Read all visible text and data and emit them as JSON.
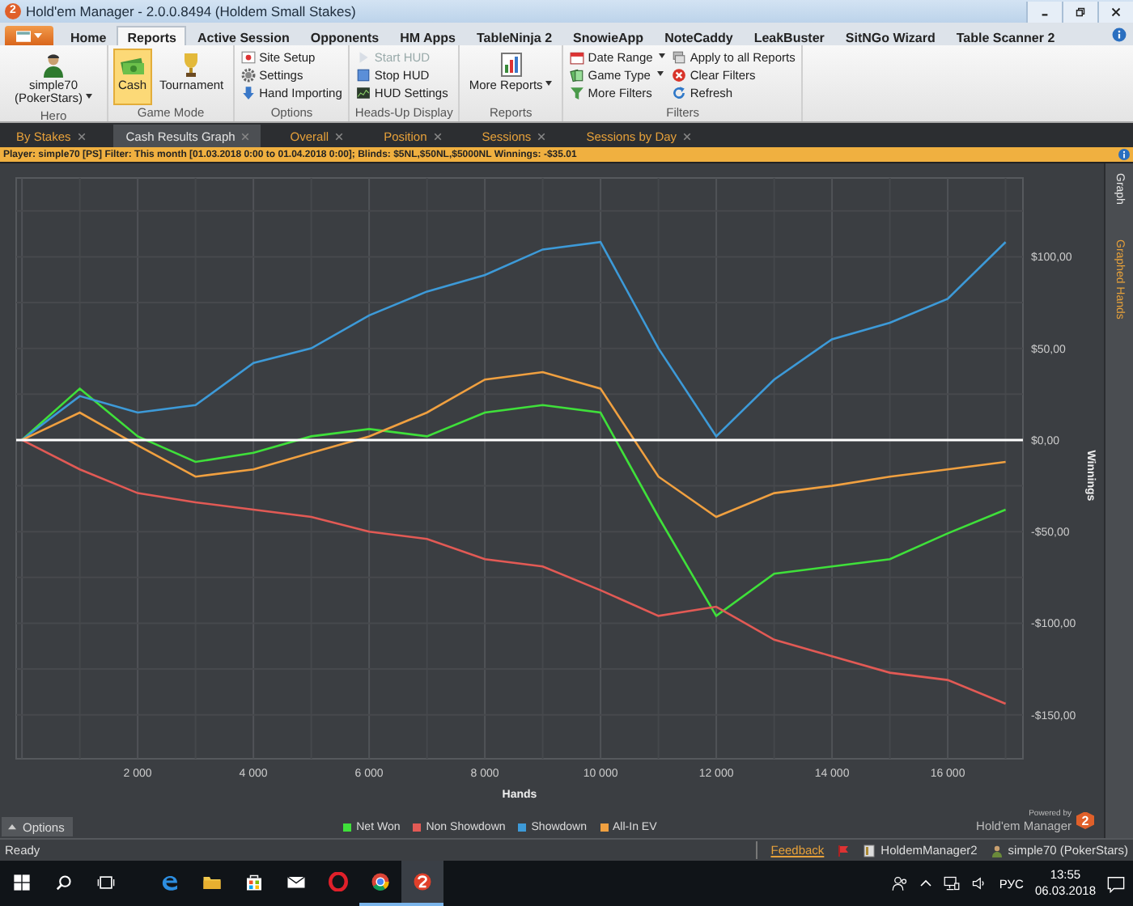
{
  "window": {
    "title": "Hold'em Manager - 2.0.0.8494 (Holdem Small Stakes)",
    "icon_text": "2"
  },
  "ribbon_tabs": [
    {
      "label": "Home",
      "selected": false
    },
    {
      "label": "Reports",
      "selected": true
    },
    {
      "label": "Active Session",
      "selected": false
    },
    {
      "label": "Opponents",
      "selected": false
    },
    {
      "label": "HM Apps",
      "selected": false
    },
    {
      "label": "TableNinja 2",
      "selected": false
    },
    {
      "label": "SnowieApp",
      "selected": false
    },
    {
      "label": "NoteCaddy",
      "selected": false
    },
    {
      "label": "LeakBuster",
      "selected": false
    },
    {
      "label": "SitNGo Wizard",
      "selected": false
    },
    {
      "label": "Table Scanner 2",
      "selected": false
    }
  ],
  "ribbon_groups": [
    {
      "label": "Hero",
      "items": [
        {
          "kind": "large",
          "label": "simple70 (PokerStars)",
          "dropdown": true
        }
      ]
    },
    {
      "label": "Game Mode",
      "items": [
        {
          "kind": "large",
          "label": "Cash",
          "selected": true
        },
        {
          "kind": "large",
          "label": "Tournament",
          "selected": false
        }
      ]
    },
    {
      "label": "Options",
      "items": [
        {
          "kind": "small",
          "label": "Site Setup"
        },
        {
          "kind": "small",
          "label": "Settings"
        },
        {
          "kind": "small",
          "label": "Hand Importing"
        }
      ]
    },
    {
      "label": "Heads-Up Display",
      "items": [
        {
          "kind": "small",
          "label": "Start HUD",
          "disabled": true
        },
        {
          "kind": "small",
          "label": "Stop HUD",
          "disabled": false
        },
        {
          "kind": "small",
          "label": "HUD Settings",
          "disabled": false
        }
      ]
    },
    {
      "label": "Reports",
      "items": [
        {
          "kind": "large",
          "label": "More Reports",
          "dropdown": true
        }
      ]
    },
    {
      "label": "Filters",
      "items": [
        {
          "kind": "small",
          "label": "Date Range",
          "dropdown": true
        },
        {
          "kind": "small",
          "label": "Game Type",
          "dropdown": true
        },
        {
          "kind": "small",
          "label": "More Filters",
          "dropdown": false
        },
        {
          "kind": "small",
          "label": "Apply to all Reports",
          "dropdown": false
        },
        {
          "kind": "small",
          "label": "Clear Filters",
          "dropdown": false
        },
        {
          "kind": "small",
          "label": "Refresh",
          "dropdown": false
        }
      ]
    }
  ],
  "report_tabs": [
    {
      "label": "By Stakes",
      "selected": false
    },
    {
      "label": "Cash Results Graph",
      "selected": true
    },
    {
      "label": "Overall",
      "selected": false
    },
    {
      "label": "Position",
      "selected": false
    },
    {
      "label": "Sessions",
      "selected": false
    },
    {
      "label": "Sessions by Day",
      "selected": false
    }
  ],
  "filter_bar": {
    "text": "Player: simple70 [PS] Filter: This month [01.03.2018 0:00 to 01.04.2018 0:00]; Blinds: $5NL,$50NL,$5000NL Winnings: -$35.01"
  },
  "side_tabs": [
    {
      "label": "Graph",
      "selected": true
    },
    {
      "label": "Graphed Hands",
      "selected": false
    }
  ],
  "graph": {
    "chart_data": {
      "type": "line",
      "xlabel": "Hands",
      "ylabel": "Winnings",
      "x": [
        0,
        1000,
        2000,
        3000,
        4000,
        5000,
        6000,
        7000,
        8000,
        9000,
        10000,
        11000,
        12000,
        13000,
        14000,
        15000,
        16000,
        17000
      ],
      "xlim": [
        -100,
        17300
      ],
      "ylim": [
        -174,
        143
      ],
      "xticks": [
        {
          "value": 2000,
          "label": "2 000"
        },
        {
          "value": 4000,
          "label": "4 000"
        },
        {
          "value": 6000,
          "label": "6 000"
        },
        {
          "value": 8000,
          "label": "8 000"
        },
        {
          "value": 10000,
          "label": "10 000"
        },
        {
          "value": 12000,
          "label": "12 000"
        },
        {
          "value": 14000,
          "label": "14 000"
        },
        {
          "value": 16000,
          "label": "16 000"
        }
      ],
      "yticks": [
        {
          "value": 100,
          "label": "$100,00"
        },
        {
          "value": 50,
          "label": "$50,00"
        },
        {
          "value": 0,
          "label": "$0,00"
        },
        {
          "value": -50,
          "label": "-$50,00"
        },
        {
          "value": -100,
          "label": "-$100,00"
        },
        {
          "value": -150,
          "label": "-$150,00"
        }
      ],
      "series": [
        {
          "name": "Net Won",
          "color": "#3fe03a",
          "values": [
            0,
            28,
            2,
            -12,
            -7,
            2,
            6,
            2,
            15,
            19,
            15,
            -42,
            -96,
            -73,
            -69,
            -65,
            -51,
            -38
          ]
        },
        {
          "name": "Non Showdown",
          "color": "#e25a55",
          "values": [
            0,
            -16,
            -29,
            -34,
            -38,
            -42,
            -50,
            -54,
            -65,
            -69,
            -82,
            -96,
            -91,
            -109,
            -118,
            -127,
            -131,
            -144
          ]
        },
        {
          "name": "Showdown",
          "color": "#3d9ad8",
          "values": [
            0,
            24,
            15,
            19,
            42,
            50,
            68,
            81,
            90,
            104,
            108,
            50,
            2,
            33,
            55,
            64,
            77,
            108
          ]
        },
        {
          "name": "All-In EV",
          "color": "#f0a040",
          "values": [
            0,
            15,
            -3,
            -20,
            -16,
            -7,
            2,
            15,
            33,
            37,
            28,
            -20,
            -42,
            -29,
            -25,
            -20,
            -16,
            -12
          ]
        }
      ],
      "grid": true,
      "ref_lines": [
        {
          "axis": "y",
          "value": 0
        }
      ]
    },
    "options_button": {
      "label": "Options"
    },
    "branding": {
      "tagline": "Powered by",
      "name": "Hold'em Manager",
      "badge": "2"
    }
  },
  "status_bar": {
    "status": "Ready",
    "link": "Feedback",
    "items": [
      "HoldemManager2",
      "simple70 (PokerStars)"
    ]
  },
  "taskbar": {
    "apps": [
      {
        "running": false,
        "selected": false
      },
      {
        "running": false,
        "selected": false
      },
      {
        "running": false,
        "selected": false
      },
      {
        "running": false,
        "selected": false
      },
      {
        "running": false,
        "selected": false
      },
      {
        "running": true,
        "selected": false
      },
      {
        "running": true,
        "selected": true
      }
    ],
    "language": "РУС",
    "time": "13:55",
    "date": "06.03.2018"
  }
}
